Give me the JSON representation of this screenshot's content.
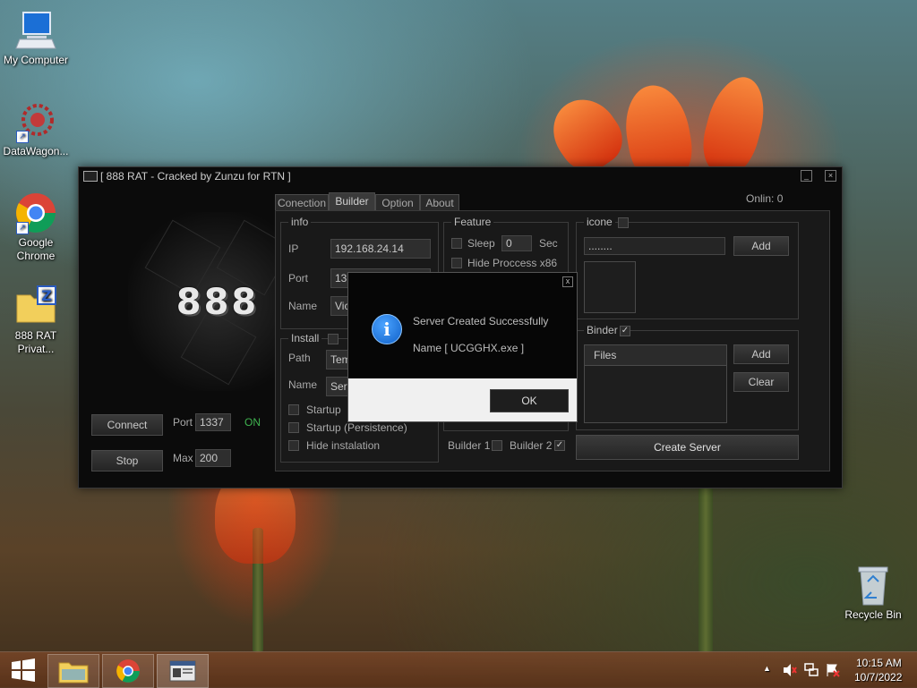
{
  "desktop": {
    "icons": [
      {
        "label": "My Computer"
      },
      {
        "label": "DataWagon..."
      },
      {
        "label": "Google Chrome"
      },
      {
        "label": "888 RAT Privat..."
      },
      {
        "label": "Recycle Bin"
      }
    ]
  },
  "window": {
    "title": "[ 888 RAT - Cracked by Zunzu for RTN ]",
    "logo_text": "888",
    "online_label": "Onlin:",
    "online_count": "0",
    "connect_label": "Connect",
    "stop_label": "Stop",
    "port_label": "Port",
    "port_value": "1337",
    "port_status": "ON",
    "max_label": "Max",
    "max_value": "200",
    "tabs": [
      "Conection",
      "Builder",
      "Option",
      "About"
    ],
    "info": {
      "title": "info",
      "ip_label": "IP",
      "ip_value": "192.168.24.14",
      "port_label": "Port",
      "port_value": "133",
      "name_label": "Name",
      "name_value": "Victi"
    },
    "install": {
      "title": "Install",
      "path_label": "Path",
      "path_value": "Temp",
      "name_label": "Name",
      "name_value": "Serve",
      "startup": "Startup",
      "startup_persistence": "Startup (Persistence)",
      "hide_installation": "Hide instalation"
    },
    "feature": {
      "title": "Feature",
      "sleep_label": "Sleep",
      "sleep_value": "0",
      "sec_label": "Sec",
      "hide_process": "Hide Proccess x86"
    },
    "icone": {
      "title": "icone",
      "path_value": "........",
      "add_label": "Add"
    },
    "binder": {
      "title": "Binder",
      "check": "✓",
      "files_header": "Files",
      "add_label": "Add",
      "clear_label": "Clear"
    },
    "builder1_label": "Builder 1",
    "builder2_label": "Builder 2",
    "builder2_check": "✓",
    "create_server_label": "Create Server"
  },
  "dialog": {
    "close": "x",
    "icon_glyph": "i",
    "line1": "Server Created Successfully",
    "line2": "Name [ UCGGHX.exe ]",
    "ok_label": "OK"
  },
  "taskbar": {
    "time": "10:15 AM",
    "date": "10/7/2022",
    "tray_arrow": "▲"
  },
  "colors": {
    "status_on": "#3fb34f",
    "accent_info": "#1f78e0"
  }
}
